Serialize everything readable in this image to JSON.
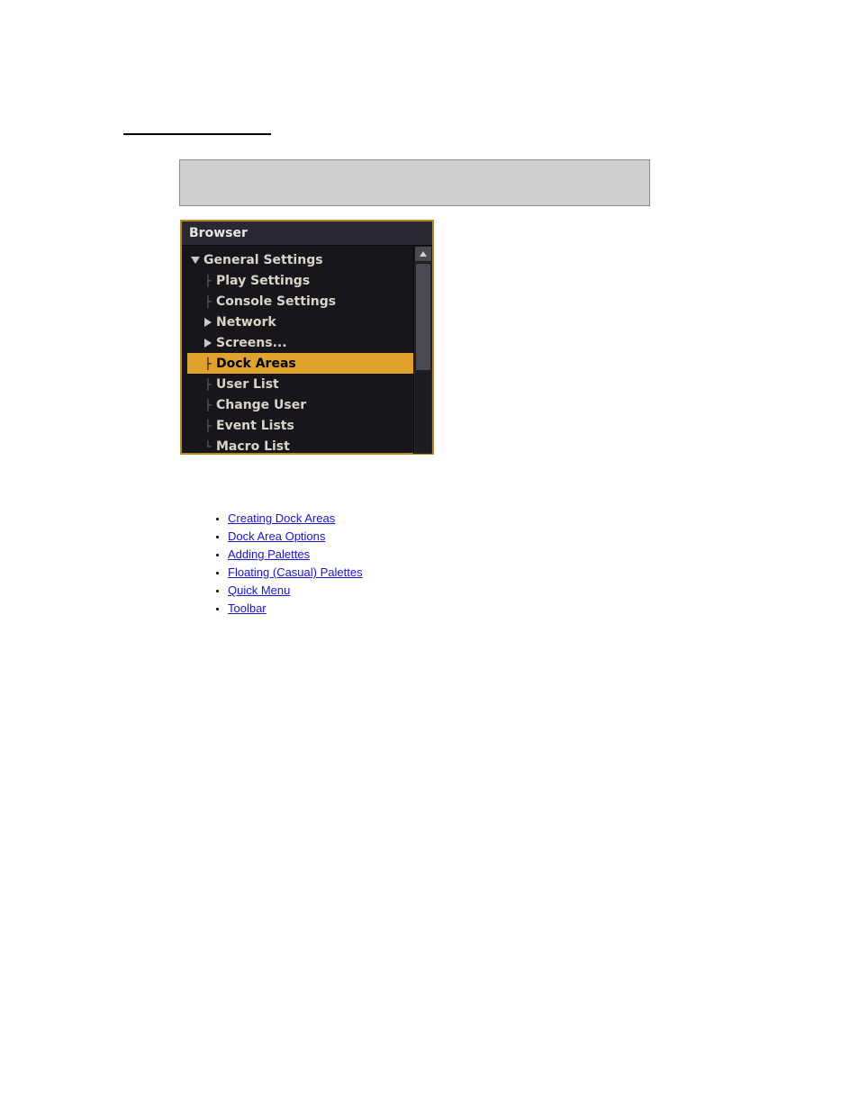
{
  "panel": {
    "title": "Browser",
    "root_label": "General Settings",
    "items": [
      {
        "label": "Play Settings",
        "expandable": false
      },
      {
        "label": "Console Settings",
        "expandable": false
      },
      {
        "label": "Network",
        "expandable": true
      },
      {
        "label": "Screens...",
        "expandable": true
      },
      {
        "label": "Dock Areas",
        "expandable": false,
        "selected": true
      },
      {
        "label": "User List",
        "expandable": false
      },
      {
        "label": "Change User",
        "expandable": false
      },
      {
        "label": "Event Lists",
        "expandable": false
      },
      {
        "label": "Macro List",
        "expandable": false
      }
    ]
  },
  "links": [
    "Creating Dock Areas",
    "Dock Area Options",
    "Adding Palettes",
    "Floating (Casual) Palettes",
    "Quick Menu",
    "Toolbar"
  ]
}
